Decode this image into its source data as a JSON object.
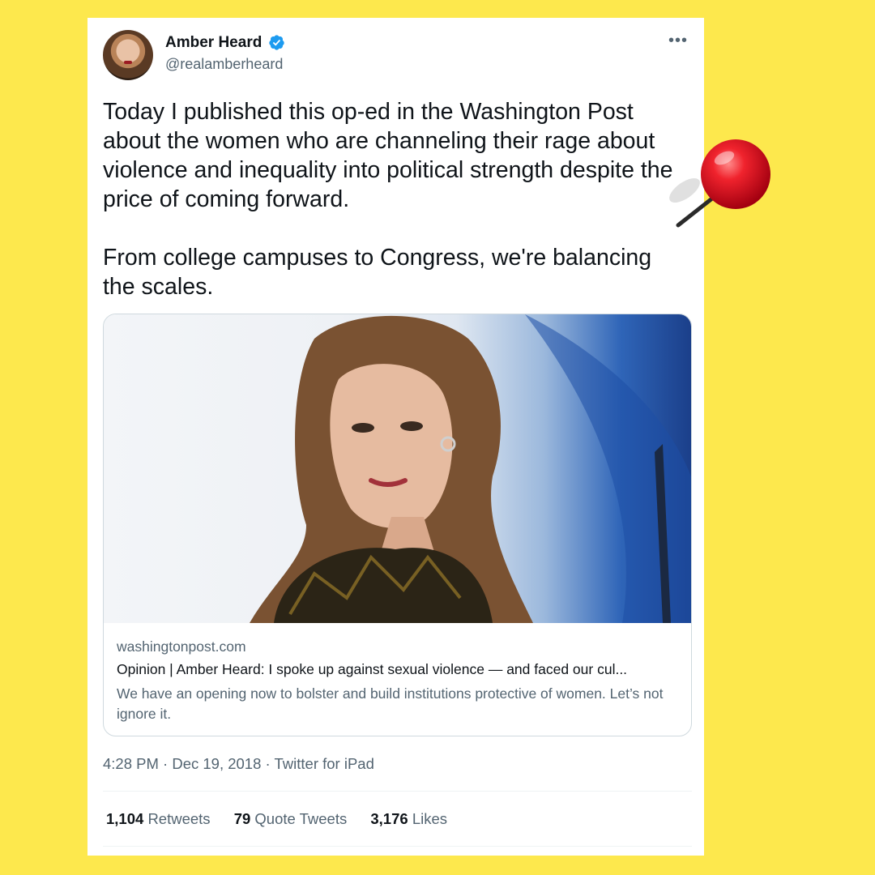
{
  "tweet": {
    "author": {
      "name": "Amber Heard",
      "handle": "@realamberheard",
      "verified": true
    },
    "more_icon": "more-dots-icon",
    "text": "Today I published this op-ed in the Washington Post about the women who are channeling their rage about violence and inequality into political strength despite the price of coming forward.\n\nFrom college campuses to Congress, we're balancing the scales.",
    "link_card": {
      "domain": "washingtonpost.com",
      "title": "Opinion | Amber Heard: I spoke up against sexual violence — and faced our cul...",
      "description": "We have an opening now to bolster and build institutions protective of women. Let’s not ignore it."
    },
    "timestamp": "4:28 PM · Dec 19, 2018 · Twitter for iPad",
    "stats": {
      "retweets": {
        "count": "1,104",
        "label": "Retweets"
      },
      "quote_tweets": {
        "count": "79",
        "label": "Quote Tweets"
      },
      "likes": {
        "count": "3,176",
        "label": "Likes"
      }
    }
  },
  "colors": {
    "background": "#fde84d",
    "verified": "#1d9bf0",
    "pin": "#e0141e",
    "secondary_text": "#536471"
  }
}
